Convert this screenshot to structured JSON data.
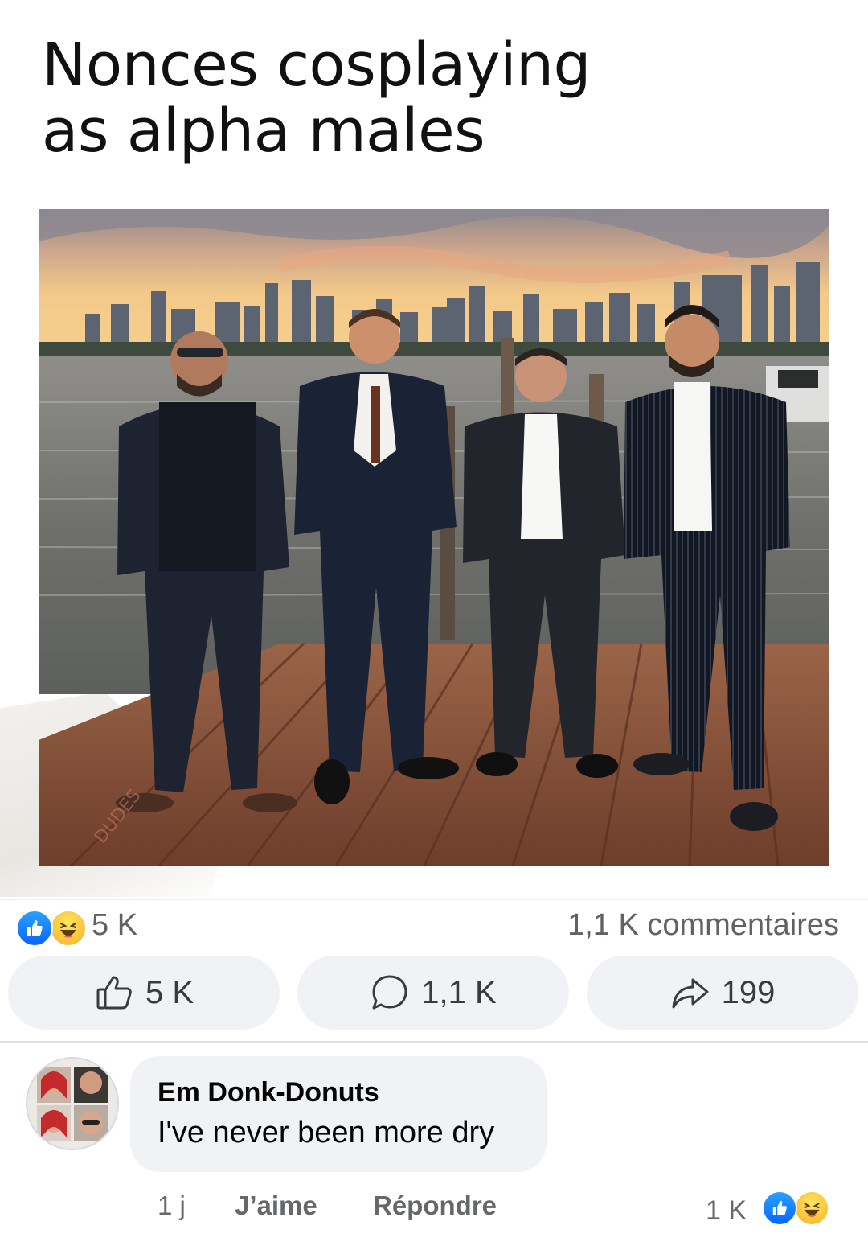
{
  "post": {
    "title_line1": "Nonces cosplaying",
    "title_line2": "as alpha males",
    "image_watermark": "DUDES"
  },
  "reactions": {
    "icons": [
      "like-icon",
      "haha-icon"
    ],
    "count": "5 K",
    "comments_label": "1,1 K commentaires"
  },
  "actions": {
    "like": {
      "icon": "thumbs-up-icon",
      "label": "5 K"
    },
    "comment": {
      "icon": "speech-bubble-icon",
      "label": "1,1 K"
    },
    "share": {
      "icon": "share-arrow-icon",
      "label": "199"
    }
  },
  "comment": {
    "author": "Em Donk-Donuts",
    "text": "I've never been more dry",
    "time": "1 j",
    "like_label": "J’aime",
    "reply_label": "Répondre",
    "reaction_count": "1 K",
    "reaction_icons": [
      "like-icon",
      "haha-icon"
    ]
  },
  "colors": {
    "like_blue": "#0866ff",
    "haha_yellow": "#f7b125",
    "button_bg": "#f0f2f5",
    "meta_gray": "#65676b"
  }
}
